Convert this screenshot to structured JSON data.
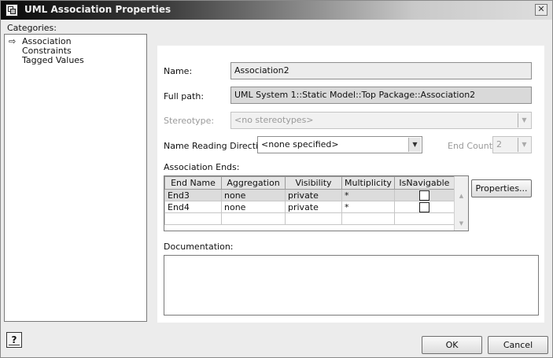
{
  "window": {
    "title": "UML Association Properties",
    "close_glyph": "✕"
  },
  "categories": {
    "label": "Categories:",
    "items": [
      {
        "label": "Association",
        "selected": true
      },
      {
        "label": "Constraints",
        "selected": false
      },
      {
        "label": "Tagged Values",
        "selected": false
      }
    ]
  },
  "form": {
    "name_label": "Name:",
    "name_value": "Association2",
    "fullpath_label": "Full path:",
    "fullpath_value": "UML System 1::Static Model::Top Package::Association2",
    "stereotype_label": "Stereotype:",
    "stereotype_value": "<no stereotypes>",
    "reading_direction_label": "Name Reading Direction:",
    "reading_direction_value": "<none specified>",
    "end_count_label": "End Count:",
    "end_count_value": "2",
    "association_ends_label": "Association Ends:",
    "documentation_label": "Documentation:",
    "documentation_value": ""
  },
  "ends_table": {
    "columns": [
      "End Name",
      "Aggregation",
      "Visibility",
      "Multiplicity",
      "IsNavigable"
    ],
    "rows": [
      {
        "end_name": "End3",
        "aggregation": "none",
        "visibility": "private",
        "multiplicity": "*",
        "is_navigable": false
      },
      {
        "end_name": "End4",
        "aggregation": "none",
        "visibility": "private",
        "multiplicity": "*",
        "is_navigable": false
      }
    ]
  },
  "buttons": {
    "properties": "Properties...",
    "ok": "OK",
    "cancel": "Cancel",
    "help": "?"
  }
}
